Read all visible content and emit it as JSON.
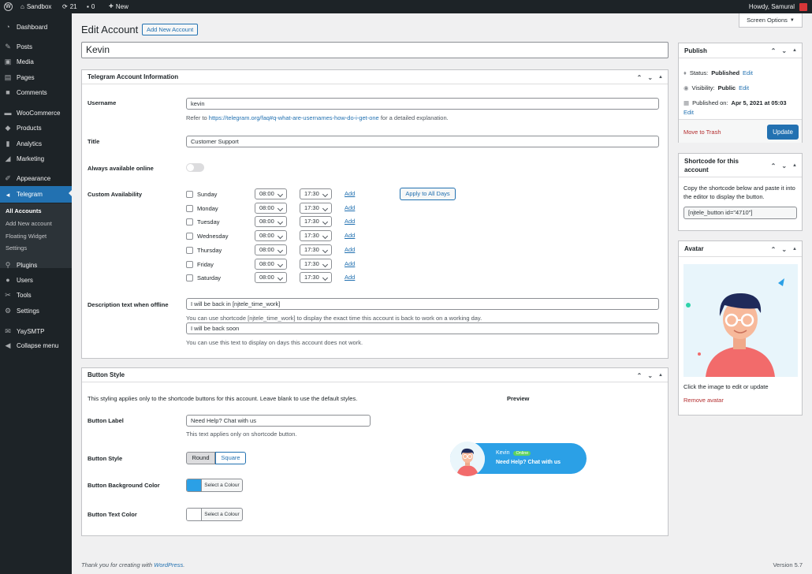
{
  "adminbar": {
    "site_name": "Sandbox",
    "updates_count": "21",
    "comments_count": "0",
    "new_label": "New",
    "howdy": "Howdy, Samural"
  },
  "sidebar": {
    "items": [
      {
        "label": "Dashboard",
        "icon": "dashboard-icon"
      },
      {
        "label": "Posts",
        "icon": "pin-icon"
      },
      {
        "label": "Media",
        "icon": "media-icon"
      },
      {
        "label": "Pages",
        "icon": "pages-icon"
      },
      {
        "label": "Comments",
        "icon": "comment-icon"
      },
      {
        "label": "WooCommerce",
        "icon": "woocommerce-icon"
      },
      {
        "label": "Products",
        "icon": "products-icon"
      },
      {
        "label": "Analytics",
        "icon": "analytics-icon"
      },
      {
        "label": "Marketing",
        "icon": "megaphone-icon"
      },
      {
        "label": "Appearance",
        "icon": "brush-icon"
      },
      {
        "label": "Telegram",
        "icon": "telegram-icon"
      },
      {
        "label": "Plugins",
        "icon": "plugin-icon"
      },
      {
        "label": "Users",
        "icon": "users-icon"
      },
      {
        "label": "Tools",
        "icon": "wrench-icon"
      },
      {
        "label": "Settings",
        "icon": "settings-icon"
      },
      {
        "label": "YaySMTP",
        "icon": "mail-icon"
      },
      {
        "label": "Collapse menu",
        "icon": "collapse-icon"
      }
    ],
    "submenu": [
      "All Accounts",
      "Add New account",
      "Floating Widget",
      "Settings"
    ]
  },
  "screen_options": "Screen Options",
  "page": {
    "title": "Edit Account",
    "add_new": "Add New Account",
    "post_title": "Kevin"
  },
  "telegram_box": {
    "title": "Telegram Account Information",
    "username_label": "Username",
    "username_value": "kevin",
    "username_help_pre": "Refer to",
    "username_help_link": "https://telegram.org/faq#q-what-are-usernames-how-do-i-get-one",
    "username_help_post": "for a detailed explanation.",
    "title_label": "Title",
    "title_value": "Customer Support",
    "online_label": "Always available online",
    "availability_label": "Custom Availability",
    "apply_all": "Apply to All Days",
    "add_label": "Add",
    "days": [
      {
        "day": "Sunday",
        "from": "08:00",
        "to": "17:30"
      },
      {
        "day": "Monday",
        "from": "08:00",
        "to": "17:30"
      },
      {
        "day": "Tuesday",
        "from": "08:00",
        "to": "17:30"
      },
      {
        "day": "Wednesday",
        "from": "08:00",
        "to": "17:30"
      },
      {
        "day": "Thursday",
        "from": "08:00",
        "to": "17:30"
      },
      {
        "day": "Friday",
        "from": "08:00",
        "to": "17:30"
      },
      {
        "day": "Saturday",
        "from": "08:00",
        "to": "17:30"
      }
    ],
    "offline_label": "Description text when offline",
    "offline_value1": "I will be back in [njtele_time_work]",
    "offline_help1": "You can use shortcode [njtele_time_work] to display the exact time this account is back to work on a working day.",
    "offline_value2": "I will be back soon",
    "offline_help2": "You can use this text to display on days this account does not work."
  },
  "button_box": {
    "title": "Button Style",
    "intro": "This styling applies only to the shortcode buttons for this account. Leave blank to use the default styles.",
    "preview_label": "Preview",
    "label_label": "Button Label",
    "label_value": "Need Help? Chat with us",
    "label_help": "This text applies only on shortcode button.",
    "style_label": "Button Style",
    "style_round": "Round",
    "style_square": "Square",
    "bg_label": "Button Background Color",
    "text_color_label": "Button Text Color",
    "select_colour": "Select a Colour",
    "bg_color": "#2ba0e6",
    "text_color": "#ffffff",
    "preview_name": "Kevin",
    "preview_status": "Online",
    "preview_text": "Need Help? Chat with us"
  },
  "publish_box": {
    "title": "Publish",
    "status_label": "Status:",
    "status_value": "Published",
    "visibility_label": "Visibility:",
    "visibility_value": "Public",
    "published_label": "Published on:",
    "published_value": "Apr 5, 2021 at 05:03",
    "edit": "Edit",
    "trash": "Move to Trash",
    "update": "Update"
  },
  "shortcode_box": {
    "title": "Shortcode for this account",
    "help": "Copy the shortcode below and paste it into the editor to display the button.",
    "shortcode": "[njtele_button id=\"4710\"]"
  },
  "avatar_box": {
    "title": "Avatar",
    "help": "Click the image to edit or update",
    "remove": "Remove avatar"
  },
  "footer": {
    "thanks_pre": "Thank you for creating with",
    "thanks_link": "WordPress",
    "thanks_post": ".",
    "version": "Version 5.7"
  }
}
